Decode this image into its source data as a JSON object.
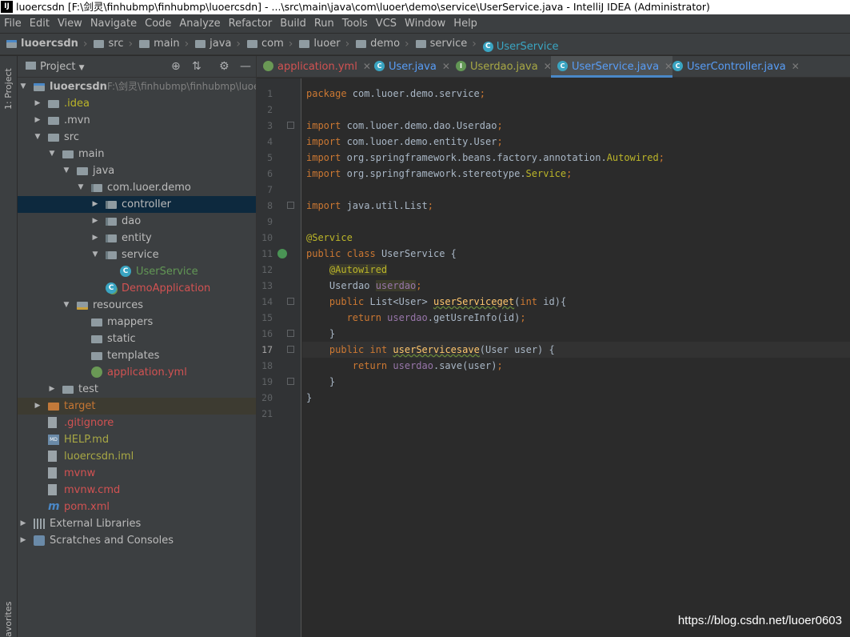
{
  "title_bar": {
    "app_icon": "IJ",
    "text": "luoercsdn [F:\\剑灵\\finhubmp\\finhubmp\\luoercsdn] - ...\\src\\main\\java\\com\\luoer\\demo\\service\\UserService.java - IntelliJ IDEA (Administrator)"
  },
  "menu": [
    "File",
    "Edit",
    "View",
    "Navigate",
    "Code",
    "Analyze",
    "Refactor",
    "Build",
    "Run",
    "Tools",
    "VCS",
    "Window",
    "Help"
  ],
  "breadcrumb": [
    "luoercsdn",
    "src",
    "main",
    "java",
    "com",
    "luoer",
    "demo",
    "service",
    "UserService"
  ],
  "side_stripe": {
    "project_tab": "1: Project",
    "favorites_tab": "avorites"
  },
  "project_panel": {
    "title": "Project",
    "tree": [
      {
        "label": "luoercsdn",
        "hint": "F:\\剑灵\\finhubmp\\finhubmp\\luoer",
        "icon": "module-folder-icon",
        "depth": 0,
        "arrow": "▼"
      },
      {
        "label": ".idea",
        "icon": "folder-icon",
        "depth": 1,
        "arrow": "▶",
        "color": "yellow"
      },
      {
        "label": ".mvn",
        "icon": "folder-icon",
        "depth": 1,
        "arrow": "▶"
      },
      {
        "label": "src",
        "icon": "folder-icon",
        "depth": 1,
        "arrow": "▼"
      },
      {
        "label": "main",
        "icon": "folder-icon",
        "depth": 2,
        "arrow": "▼"
      },
      {
        "label": "java",
        "icon": "folder-icon",
        "depth": 3,
        "arrow": "▼"
      },
      {
        "label": "com.luoer.demo",
        "icon": "package-icon",
        "depth": 4,
        "arrow": "▼"
      },
      {
        "label": "controller",
        "icon": "package-icon",
        "depth": 5,
        "arrow": "▶",
        "selected": true
      },
      {
        "label": "dao",
        "icon": "package-icon",
        "depth": 5,
        "arrow": "▶"
      },
      {
        "label": "entity",
        "icon": "package-icon",
        "depth": 5,
        "arrow": "▶"
      },
      {
        "label": "service",
        "icon": "package-icon",
        "depth": 5,
        "arrow": "▼"
      },
      {
        "label": "UserService",
        "icon": "class-icon",
        "depth": 6,
        "arrow": "",
        "color": "green"
      },
      {
        "label": "DemoApplication",
        "icon": "spring-class-icon",
        "depth": 5,
        "arrow": "",
        "color": "red"
      },
      {
        "label": "resources",
        "icon": "resources-folder-icon",
        "depth": 3,
        "arrow": "▼"
      },
      {
        "label": "mappers",
        "icon": "folder-icon",
        "depth": 4,
        "arrow": ""
      },
      {
        "label": "static",
        "icon": "folder-icon",
        "depth": 4,
        "arrow": ""
      },
      {
        "label": "templates",
        "icon": "folder-icon",
        "depth": 4,
        "arrow": ""
      },
      {
        "label": "application.yml",
        "icon": "yml-icon",
        "depth": 4,
        "arrow": "",
        "color": "red"
      },
      {
        "label": "test",
        "icon": "folder-icon",
        "depth": 2,
        "arrow": "▶"
      },
      {
        "label": "target",
        "icon": "orange-folder-icon",
        "depth": 1,
        "arrow": "▶",
        "color": "orange",
        "highlight": true
      },
      {
        "label": ".gitignore",
        "icon": "file-icon",
        "depth": 1,
        "arrow": "",
        "color": "red"
      },
      {
        "label": "HELP.md",
        "icon": "markdown-icon",
        "depth": 1,
        "arrow": "",
        "color": "olive"
      },
      {
        "label": "luoercsdn.iml",
        "icon": "file-icon",
        "depth": 1,
        "arrow": "",
        "color": "olive"
      },
      {
        "label": "mvnw",
        "icon": "file-icon",
        "depth": 1,
        "arrow": "",
        "color": "red"
      },
      {
        "label": "mvnw.cmd",
        "icon": "file-icon",
        "depth": 1,
        "arrow": "",
        "color": "red"
      },
      {
        "label": "pom.xml",
        "icon": "maven-icon",
        "depth": 1,
        "arrow": "",
        "color": "red"
      },
      {
        "label": "External Libraries",
        "icon": "library-icon",
        "depth": 0,
        "arrow": "▶"
      },
      {
        "label": "Scratches and Consoles",
        "icon": "scratches-icon",
        "depth": 0,
        "arrow": "▶"
      }
    ]
  },
  "editor": {
    "tabs": [
      {
        "label": "application.yml",
        "icon_color": "#6a9955",
        "color": "red",
        "active": false
      },
      {
        "label": "User.java",
        "icon_color": "#3aa5c2",
        "icon_letter": "C",
        "color": "blue",
        "active": false
      },
      {
        "label": "Userdao.java",
        "icon_color": "#629755",
        "icon_letter": "I",
        "color": "olive",
        "active": false
      },
      {
        "label": "UserService.java",
        "icon_color": "#3aa5c2",
        "icon_letter": "C",
        "color": "blue",
        "active": true
      },
      {
        "label": "UserController.java",
        "icon_color": "#3aa5c2",
        "icon_letter": "C",
        "color": "blue",
        "active": false
      }
    ],
    "current_line": 17,
    "lines": [
      "package com.luoer.demo.service;",
      "",
      "import com.luoer.demo.dao.Userdao;",
      "import com.luoer.demo.entity.User;",
      "import org.springframework.beans.factory.annotation.Autowired;",
      "import org.springframework.stereotype.Service;",
      "",
      "import java.util.List;",
      "",
      "@Service",
      "public class UserService {",
      "    @Autowired",
      "    Userdao userdao;",
      "    public List<User> userServiceget(int id){",
      "       return userdao.getUsreInfo(id);",
      "    }",
      "    public int userServicesave(User user) {",
      "        return userdao.save(user);",
      "    }",
      "}",
      ""
    ]
  },
  "watermark": "https://blog.csdn.net/luoer0603"
}
